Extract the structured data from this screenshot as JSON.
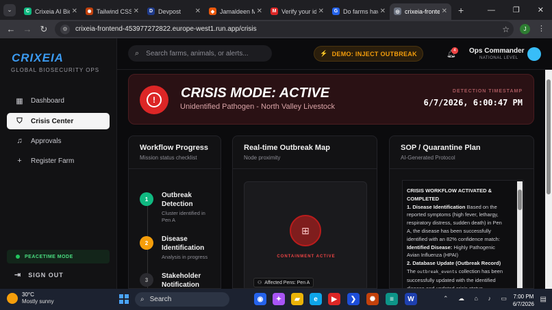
{
  "browser": {
    "tabs": [
      {
        "title": "Crixeia AI Bio",
        "color": "#10b981",
        "glyph": "C"
      },
      {
        "title": "Tailwind CSS",
        "color": "#c2410c",
        "glyph": "✺"
      },
      {
        "title": "Devpost",
        "color": "#1e3a8a",
        "glyph": "D"
      },
      {
        "title": "Jamaldeen M",
        "color": "#ea580c",
        "glyph": "◆"
      },
      {
        "title": "Verify your id",
        "color": "#dc2626",
        "glyph": "M"
      },
      {
        "title": "Do farms hav",
        "color": "#2563eb",
        "glyph": "G"
      },
      {
        "title": "crixeia-fronte",
        "color": "#6b7280",
        "glyph": "◎"
      }
    ],
    "active_tab": 6,
    "url": "crixeia-frontend-453977272822.europe-west1.run.app/crisis",
    "profile_initial": "J"
  },
  "sidebar": {
    "brand": "CRIXEIA",
    "brand_sub": "GLOBAL BIOSECURITY OPS",
    "items": [
      {
        "label": "Dashboard",
        "icon": "▦"
      },
      {
        "label": "Crisis Center",
        "icon": "⛉"
      },
      {
        "label": "Approvals",
        "icon": "♫"
      },
      {
        "label": "Register Farm",
        "icon": "+"
      }
    ],
    "mode": "PEACETIME MODE",
    "signout": "SIGN OUT"
  },
  "topbar": {
    "search_placeholder": "Search farms, animals, or alerts...",
    "demo_button": "DEMO: INJECT OUTBREAK",
    "notif_count": "4",
    "user_name": "Ops Commander",
    "user_level": "NATIONAL LEVEL"
  },
  "crisis": {
    "title": "CRISIS MODE: ACTIVE",
    "subtitle": "Unidentified Pathogen - North Valley Livestock",
    "timestamp_label": "DETECTION TIMESTAMP",
    "timestamp": "6/7/2026, 6:00:47 PM"
  },
  "workflow": {
    "title": "Workflow Progress",
    "subtitle": "Mission status checklist",
    "steps": [
      {
        "num": "1",
        "title": "Outbreak Detection",
        "desc": "Cluster identified in Pen A",
        "color": "#10b981"
      },
      {
        "num": "2",
        "title": "Disease Identification",
        "desc": "Analysis in progress",
        "color": "#f59e0b"
      },
      {
        "num": "3",
        "title": "Stakeholder Notification",
        "desc": "",
        "color": "#2b2b30"
      }
    ]
  },
  "map": {
    "title": "Real-time Outbreak Map",
    "subtitle": "Node proximity",
    "status": "CONTAINMENT ACTIVE",
    "pens_label": "Affected Pens: Pen A"
  },
  "sop": {
    "title": "SOP / Quarantine Plan",
    "subtitle": "AI-Generated Protocol",
    "header": "CRISIS WORKFLOW ACTIVATED & COMPLETED",
    "s1_head": "1. Disease Identification",
    "s1_body": " Based on the reported symptoms (high fever, lethargy, respiratory distress, sudden death) in Pen A, the disease has been successfully identified with an 82% confidence match:",
    "s1_label": "Identified Disease:",
    "s1_value": " Highly Pathogenic Avian Influenza (HPAI)",
    "s2_head": "2. Database Update (Outbreak Record)",
    "s2_pre": "The ",
    "s2_code": "outbreak_events",
    "s2_post": " collection has been successfully updated with the identified disease and updated crisis status."
  },
  "taskbar": {
    "temp": "30°C",
    "condition": "Mostly sunny",
    "search": "Search",
    "time": "7:00 PM",
    "date": "6/7/2026",
    "apps": [
      {
        "name": "chrome",
        "color": "#2563eb",
        "glyph": "◉"
      },
      {
        "name": "copilot",
        "color": "#a855f7",
        "glyph": "✦"
      },
      {
        "name": "file-explorer",
        "color": "#eab308",
        "glyph": "▰"
      },
      {
        "name": "edge",
        "color": "#0ea5e9",
        "glyph": "e"
      },
      {
        "name": "youtube",
        "color": "#dc2626",
        "glyph": "▶"
      },
      {
        "name": "vscode",
        "color": "#1d4ed8",
        "glyph": "❯"
      },
      {
        "name": "claude",
        "color": "#c2410c",
        "glyph": "✺"
      },
      {
        "name": "notepad",
        "color": "#0d9488",
        "glyph": "≡"
      },
      {
        "name": "word",
        "color": "#1e40af",
        "glyph": "W"
      }
    ]
  }
}
